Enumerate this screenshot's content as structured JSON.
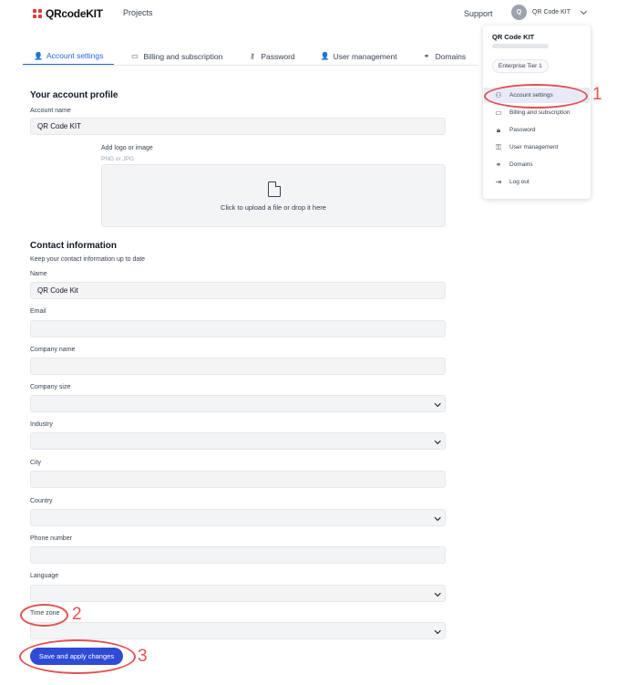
{
  "header": {
    "brand": "QRcodeKIT",
    "projects": "Projects",
    "support": "Support",
    "avatar_initial": "Q",
    "user_name": "QR Code KIT"
  },
  "tabs": [
    {
      "label": "Account settings",
      "icon": "user-icon",
      "glyph": "👤"
    },
    {
      "label": "Billing and subscription",
      "icon": "card-icon",
      "glyph": "▭"
    },
    {
      "label": "Password",
      "icon": "key-icon",
      "glyph": "⚷"
    },
    {
      "label": "User management",
      "icon": "user-icon",
      "glyph": "👤"
    },
    {
      "label": "Domains",
      "icon": "link-icon",
      "glyph": "⚭"
    }
  ],
  "profile": {
    "title": "Your account profile",
    "account_name_label": "Account name",
    "account_name_value": "QR Code KIT",
    "logo_label": "Add logo or image",
    "logo_hint": "PNG or JPG",
    "upload_text": "Click to upload a file or drop it here"
  },
  "contact": {
    "title": "Contact information",
    "subtitle": "Keep your contact information up to date",
    "name_label": "Name",
    "name_value": "QR Code Kit",
    "email_label": "Email",
    "company_label": "Company name",
    "company_size_label": "Company size",
    "industry_label": "Industry",
    "city_label": "City",
    "country_label": "Country",
    "phone_label": "Phone number",
    "language_label": "Language",
    "timezone_label": "Time zone"
  },
  "save_button": "Save and apply changes",
  "menu": {
    "name": "QR Code KIT",
    "tier": "Enterprise Tier 1",
    "items": [
      {
        "label": "Account settings",
        "icon": "user-icon",
        "glyph": "⚇"
      },
      {
        "label": "Billing and subscription",
        "icon": "card-icon",
        "glyph": "▭"
      },
      {
        "label": "Password",
        "icon": "lock-icon",
        "glyph": "🔒︎"
      },
      {
        "label": "User management",
        "icon": "key-icon",
        "glyph": "⚿"
      },
      {
        "label": "Domains",
        "icon": "link-icon",
        "glyph": "⚭"
      },
      {
        "label": "Log out",
        "icon": "logout-icon",
        "glyph": "⇥"
      }
    ]
  },
  "annotations": [
    "1",
    "2",
    "3"
  ],
  "colors": {
    "accent": "#2563eb",
    "button": "#2f4bd6",
    "annotation": "#e05252",
    "brand": "#e53935"
  }
}
